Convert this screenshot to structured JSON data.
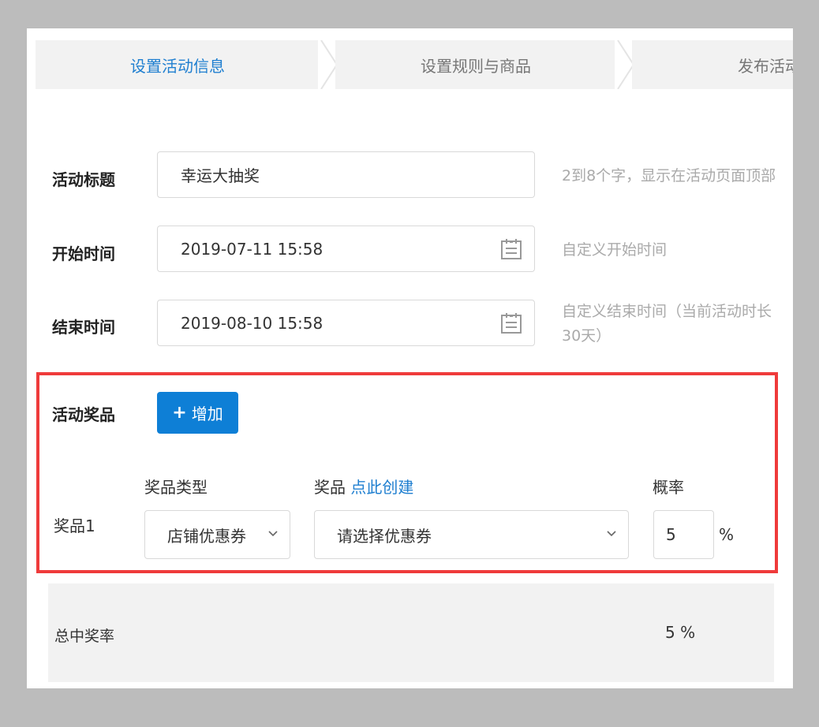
{
  "steps": [
    "设置活动信息",
    "设置规则与商品",
    "发布活动"
  ],
  "form": {
    "title": {
      "label": "活动标题",
      "value": "幸运大抽奖",
      "hint": "2到8个字，显示在活动页面顶部"
    },
    "start": {
      "label": "开始时间",
      "value": "2019-07-11 15:58",
      "hint": "自定义开始时间"
    },
    "end": {
      "label": "结束时间",
      "value": "2019-08-10 15:58",
      "hint_line1": "自定义结束时间（当前活动时长",
      "hint_line2": "30天）"
    }
  },
  "prizes": {
    "label": "活动奖品",
    "add_plus": "+",
    "add_label": "增加",
    "col_type": "奖品类型",
    "col_prize": "奖品",
    "col_prize_link": "点此创建",
    "col_prob": "概率",
    "items": [
      {
        "name": "奖品1",
        "type": "店铺优惠券",
        "prize_placeholder": "请选择优惠券",
        "probability": "5",
        "unit": "%"
      }
    ]
  },
  "summary": {
    "label": "总中奖率",
    "value": "5 %"
  },
  "colors": {
    "accent": "#0e7fd6",
    "highlight": "#ef3b3b",
    "link": "#1f7fd0"
  },
  "icons": [
    "calendar-icon",
    "chevron-down-icon"
  ]
}
